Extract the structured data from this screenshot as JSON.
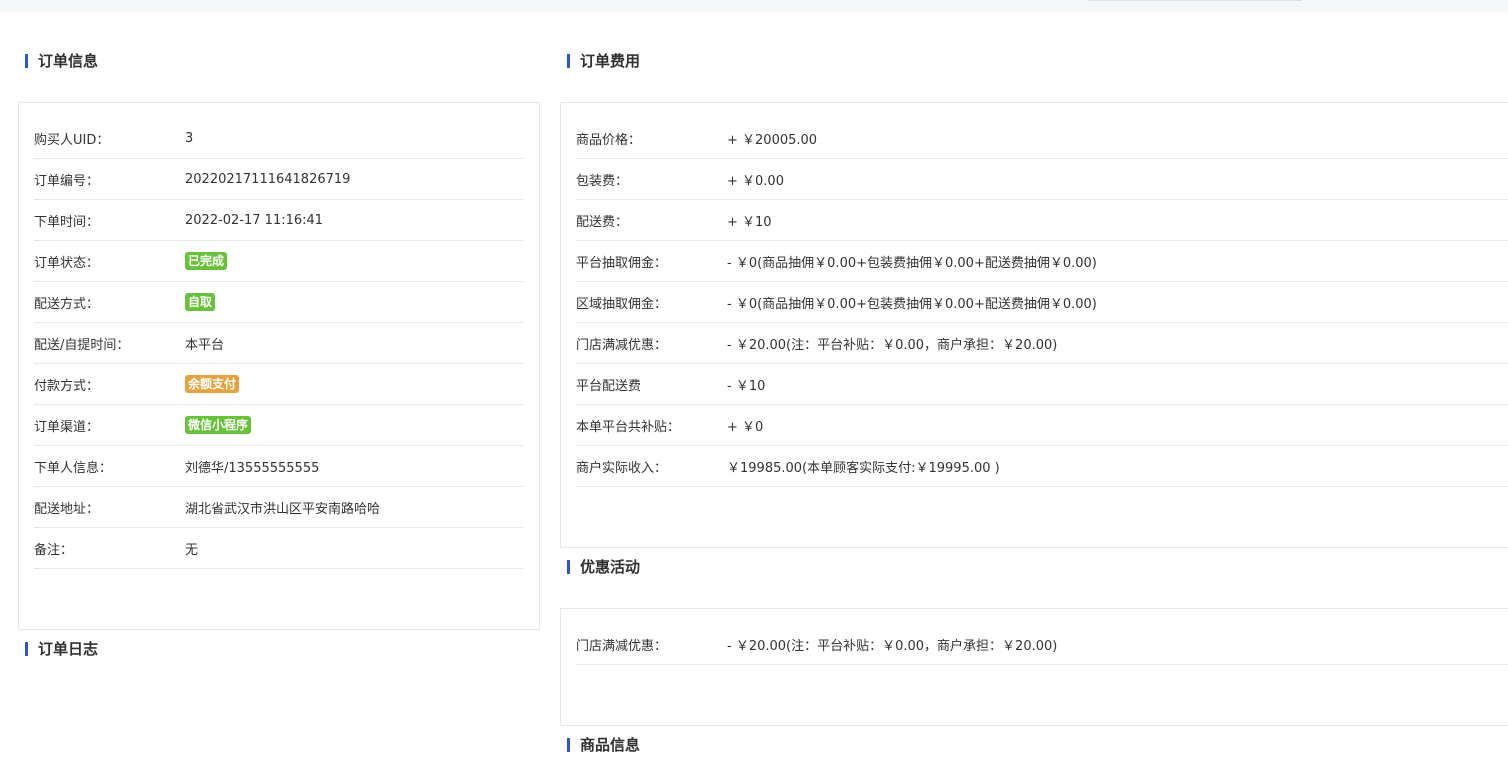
{
  "sections": {
    "order_info": "订单信息",
    "order_fees": "订单费用",
    "order_log": "订单日志",
    "promotions": "优惠活动",
    "product_info": "商品信息"
  },
  "order_info_rows": [
    {
      "label": "购买人UID：",
      "value": "3"
    },
    {
      "label": "订单编号：",
      "value": "20220217111641826719"
    },
    {
      "label": "下单时间：",
      "value": "2022-02-17 11:16:41"
    },
    {
      "label": "订单状态：",
      "tag": "已完成",
      "tag_color": "#67c23a"
    },
    {
      "label": "配送方式：",
      "tag": "自取",
      "tag_color": "#67c23a"
    },
    {
      "label": "配送/自提时间：",
      "value": "本平台"
    },
    {
      "label": "付款方式：",
      "tag": "余额支付",
      "tag_color": "#e6a23c"
    },
    {
      "label": "订单渠道：",
      "tag": "微信小程序",
      "tag_color": "#67c23a"
    },
    {
      "label": "下单人信息：",
      "value": "刘德华/13555555555"
    },
    {
      "label": "配送地址：",
      "value": "湖北省武汉市洪山区平安南路哈哈"
    },
    {
      "label": "备注：",
      "value": "无"
    }
  ],
  "fee_rows": [
    {
      "label": "商品价格：",
      "value": "+ ￥20005.00"
    },
    {
      "label": "包装费：",
      "value": "+ ￥0.00"
    },
    {
      "label": "配送费：",
      "value": "+ ￥10"
    },
    {
      "label": "平台抽取佣金：",
      "value": "- ￥0(商品抽佣￥0.00+包装费抽佣￥0.00+配送费抽佣￥0.00)"
    },
    {
      "label": "区域抽取佣金：",
      "value": "- ￥0(商品抽佣￥0.00+包装费抽佣￥0.00+配送费抽佣￥0.00)"
    },
    {
      "label": "门店满减优惠：",
      "value": "- ￥20.00(注：平台补贴：￥0.00，商户承担：￥20.00)"
    },
    {
      "label": "平台配送费",
      "value": "- ￥10"
    },
    {
      "label": "本单平台共补贴：",
      "value": "+ ￥0"
    },
    {
      "label": "商户实际收入：",
      "value": "￥19985.00(本单顾客实际支付:￥19995.00 )"
    }
  ],
  "promo_rows": [
    {
      "label": "门店满减优惠：",
      "value": "- ￥20.00(注：平台补贴：￥0.00，商户承担：￥20.00)"
    }
  ]
}
